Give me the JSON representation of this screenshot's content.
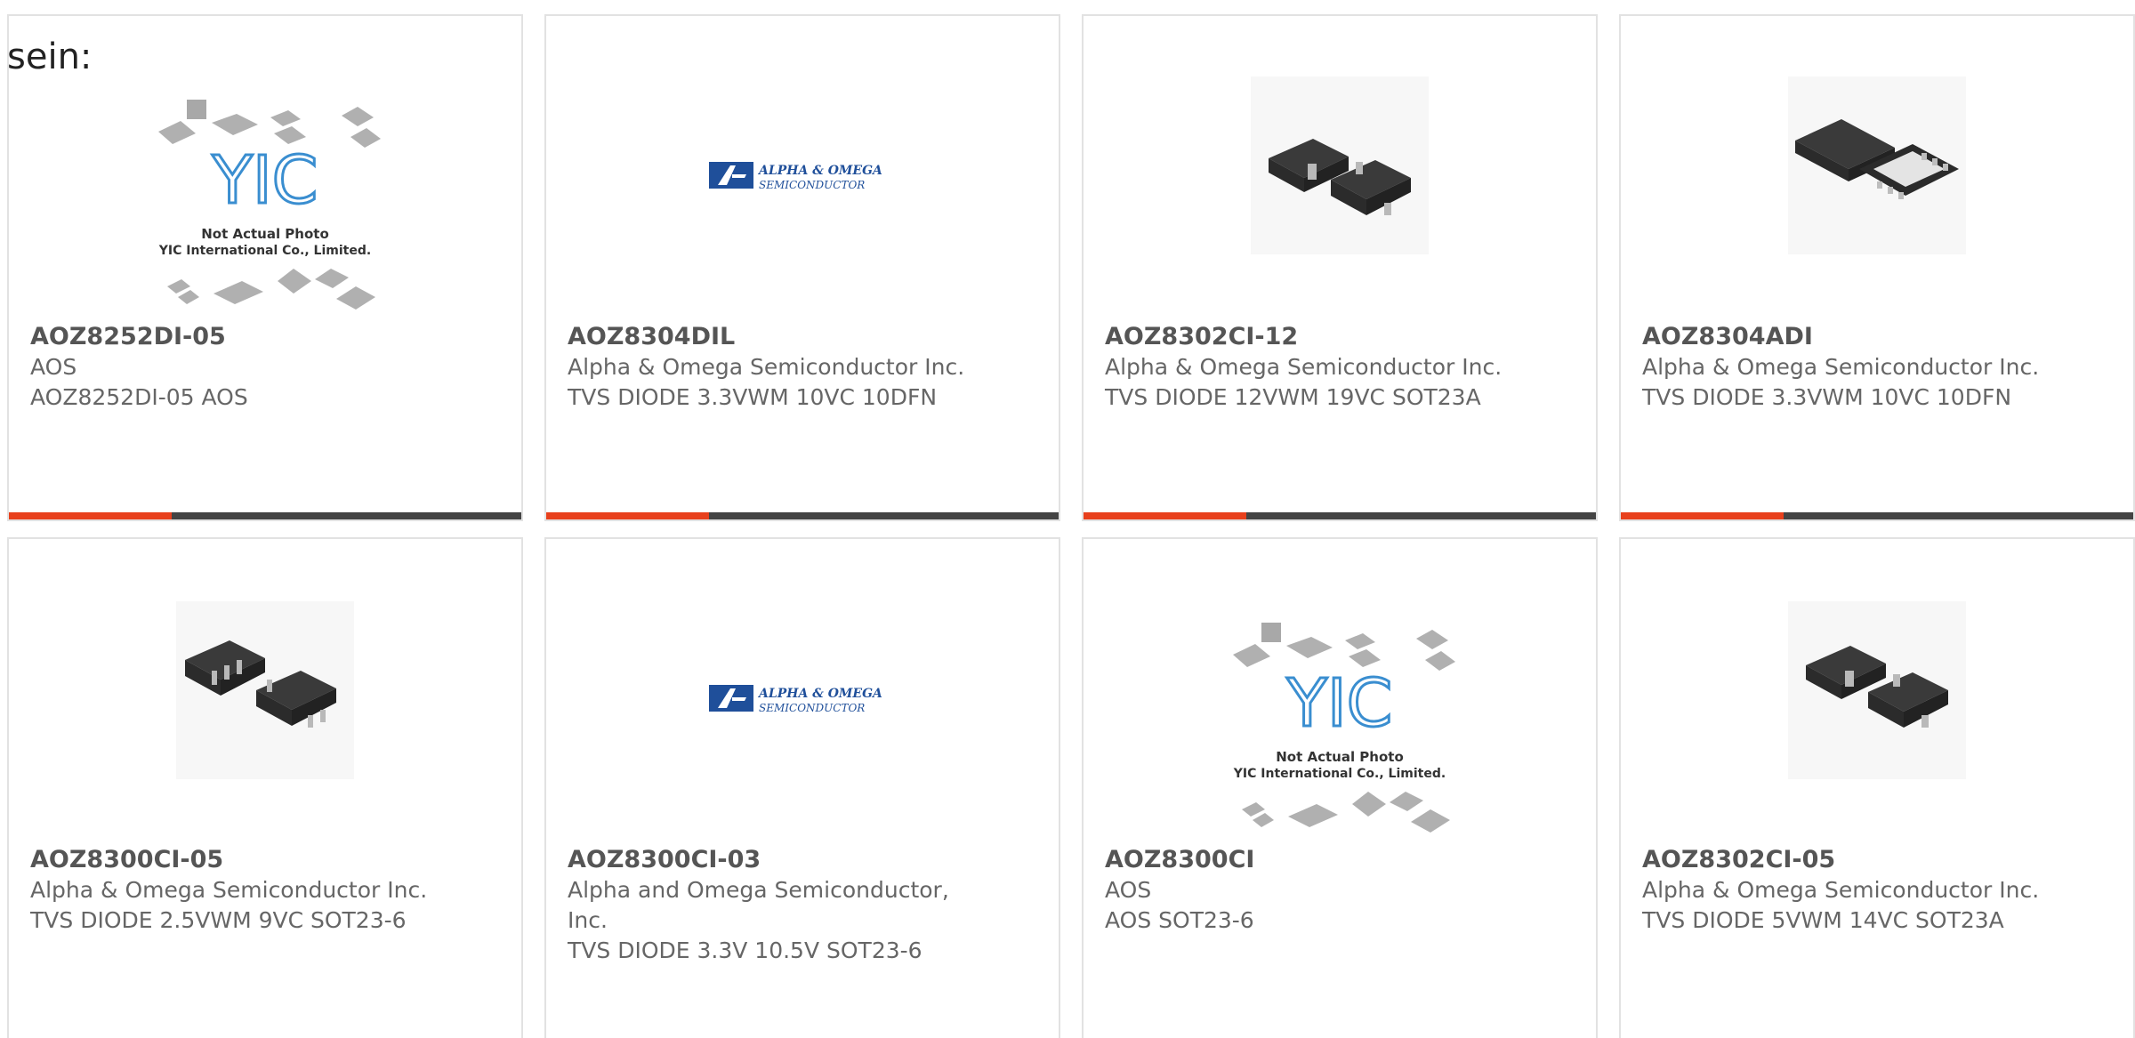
{
  "intro_text": "sein:",
  "cards": [
    {
      "part_number": "AOZ8252DI-05",
      "manufacturer": "AOS",
      "description": "AOZ8252DI-05 AOS",
      "image": "not-actual-photo",
      "image_caption_1": "Not Actual Photo",
      "image_caption_2": "YIC International Co., Limited.",
      "logo_text": "YIC"
    },
    {
      "part_number": "AOZ8304DIL",
      "manufacturer": "Alpha & Omega Semiconductor Inc.",
      "description": "TVS DIODE 3.3VWM 10VC 10DFN",
      "image": "alpha-omega-logo",
      "logo_line1": "ALPHA & OMEGA",
      "logo_line2": "SEMICONDUCTOR"
    },
    {
      "part_number": "AOZ8302CI-12",
      "manufacturer": "Alpha & Omega Semiconductor Inc.",
      "description": "TVS DIODE 12VWM 19VC SOT23A",
      "image": "sot23-package"
    },
    {
      "part_number": "AOZ8304ADI",
      "manufacturer": "Alpha & Omega Semiconductor Inc.",
      "description": "TVS DIODE 3.3VWM 10VC 10DFN",
      "image": "dfn-package"
    },
    {
      "part_number": "AOZ8300CI-05",
      "manufacturer": "Alpha & Omega Semiconductor Inc.",
      "description": "TVS DIODE 2.5VWM 9VC SOT23-6",
      "image": "sot23-6-package"
    },
    {
      "part_number": "AOZ8300CI-03",
      "manufacturer": "Alpha and Omega Semiconductor, Inc.",
      "description": "TVS DIODE 3.3V 10.5V SOT23-6",
      "image": "alpha-omega-logo",
      "logo_line1": "ALPHA & OMEGA",
      "logo_line2": "SEMICONDUCTOR"
    },
    {
      "part_number": "AOZ8300CI",
      "manufacturer": "AOS",
      "description": "AOS SOT23-6",
      "image": "not-actual-photo",
      "image_caption_1": "Not Actual Photo",
      "image_caption_2": "YIC International Co., Limited.",
      "logo_text": "YIC"
    },
    {
      "part_number": "AOZ8302CI-05",
      "manufacturer": "Alpha & Omega Semiconductor Inc.",
      "description": "TVS DIODE 5VWM 14VC SOT23A",
      "image": "sot23-package"
    }
  ],
  "colors": {
    "accent": "#e8401c",
    "bar": "#444444",
    "border": "#e2e2e2"
  }
}
